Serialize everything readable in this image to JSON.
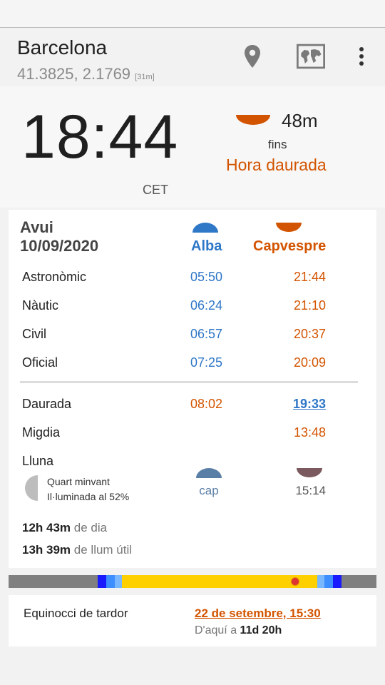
{
  "header": {
    "city": "Barcelona",
    "coords": "41.3825, 2.1769",
    "altitude": "[31m]",
    "icons": [
      "location-pin-icon",
      "map-icon",
      "more-vert-icon"
    ]
  },
  "clock": {
    "time": "18:44",
    "timezone": "CET",
    "countdown": "48m",
    "until_label": "fins",
    "next_event": "Hora daurada"
  },
  "today": {
    "label": "Avui",
    "date": "10/09/2020",
    "col_dawn": "Alba",
    "col_dusk": "Capvespre",
    "rows": [
      {
        "label": "Astronòmic",
        "dawn": "05:50",
        "dusk": "21:44"
      },
      {
        "label": "Nàutic",
        "dawn": "06:24",
        "dusk": "21:10"
      },
      {
        "label": "Civil",
        "dawn": "06:57",
        "dusk": "20:37"
      },
      {
        "label": "Oficial",
        "dawn": "07:25",
        "dusk": "20:09"
      }
    ],
    "golden": {
      "label": "Daurada",
      "dawn": "08:02",
      "dusk": "19:33"
    },
    "noon": {
      "label": "Migdia",
      "time": "13:48"
    },
    "moon": {
      "label": "Lluna",
      "phase": "Quart minvant",
      "illumination": "Il·luminada al 52%",
      "rise": "cap",
      "set": "15:14"
    },
    "day_length": "12h 43m",
    "day_length_label": "de dia",
    "useful_light": "13h 39m",
    "useful_light_label": "de llum útil"
  },
  "equinox": {
    "label": "Equinocci de tardor",
    "date": "22 de setembre, 15:30",
    "until_prefix": "D'aquí a",
    "until_value": "11d 20h"
  },
  "colors": {
    "dawn_blue": "#2f77c7",
    "dusk_orange": "#d35400",
    "day_yellow": "#ffd000",
    "night_gray": "#808080"
  }
}
